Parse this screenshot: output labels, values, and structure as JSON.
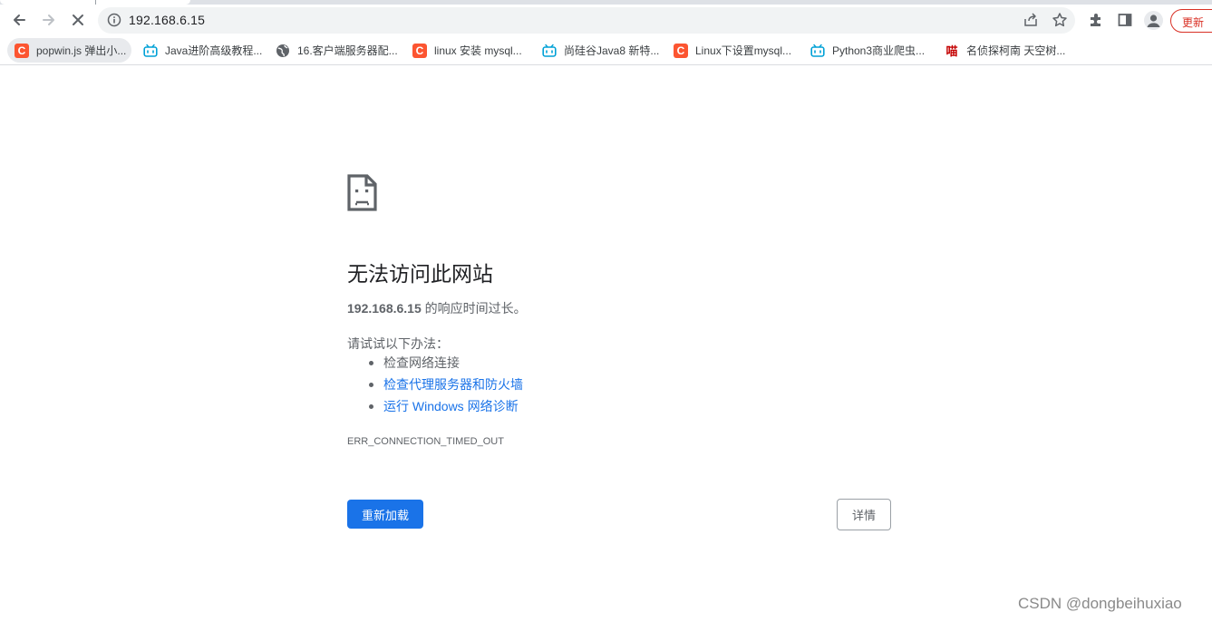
{
  "browser": {
    "url": "192.168.6.15",
    "update_label": "更新"
  },
  "bookmarks": [
    {
      "icon": "csdn-favicon",
      "label": "popwin.js 弹出小..."
    },
    {
      "icon": "bilibili-favicon",
      "label": "Java进阶高级教程..."
    },
    {
      "icon": "globe-icon",
      "label": "16.客户端服务器配..."
    },
    {
      "icon": "csdn-favicon",
      "label": "linux 安装 mysql..."
    },
    {
      "icon": "bilibili-favicon",
      "label": "尚硅谷Java8 新特..."
    },
    {
      "icon": "csdn-favicon",
      "label": "Linux下设置mysql..."
    },
    {
      "icon": "bilibili-favicon",
      "label": "Python3商业爬虫..."
    },
    {
      "icon": "miao-favicon",
      "label": "名侦探柯南 天空树..."
    }
  ],
  "favicon_text": {
    "csdn": "C",
    "miao": "喵"
  },
  "error": {
    "title": "无法访问此网站",
    "host": "192.168.6.15",
    "summary_suffix": " 的响应时间过长。",
    "suggestions_heading": "请试试以下办法：",
    "suggestions": [
      {
        "label": "检查网络连接",
        "link": false
      },
      {
        "label": "检查代理服务器和防火墙",
        "link": true
      },
      {
        "label": "运行 Windows 网络诊断",
        "link": true
      }
    ],
    "code": "ERR_CONNECTION_TIMED_OUT",
    "reload_label": "重新加载",
    "details_label": "详情"
  },
  "watermark": "CSDN @dongbeihuxiao",
  "colors": {
    "accent": "#1a73e8",
    "update": "#d93025",
    "csdn": "#fc5531",
    "bilibili": "#00a1d6"
  }
}
